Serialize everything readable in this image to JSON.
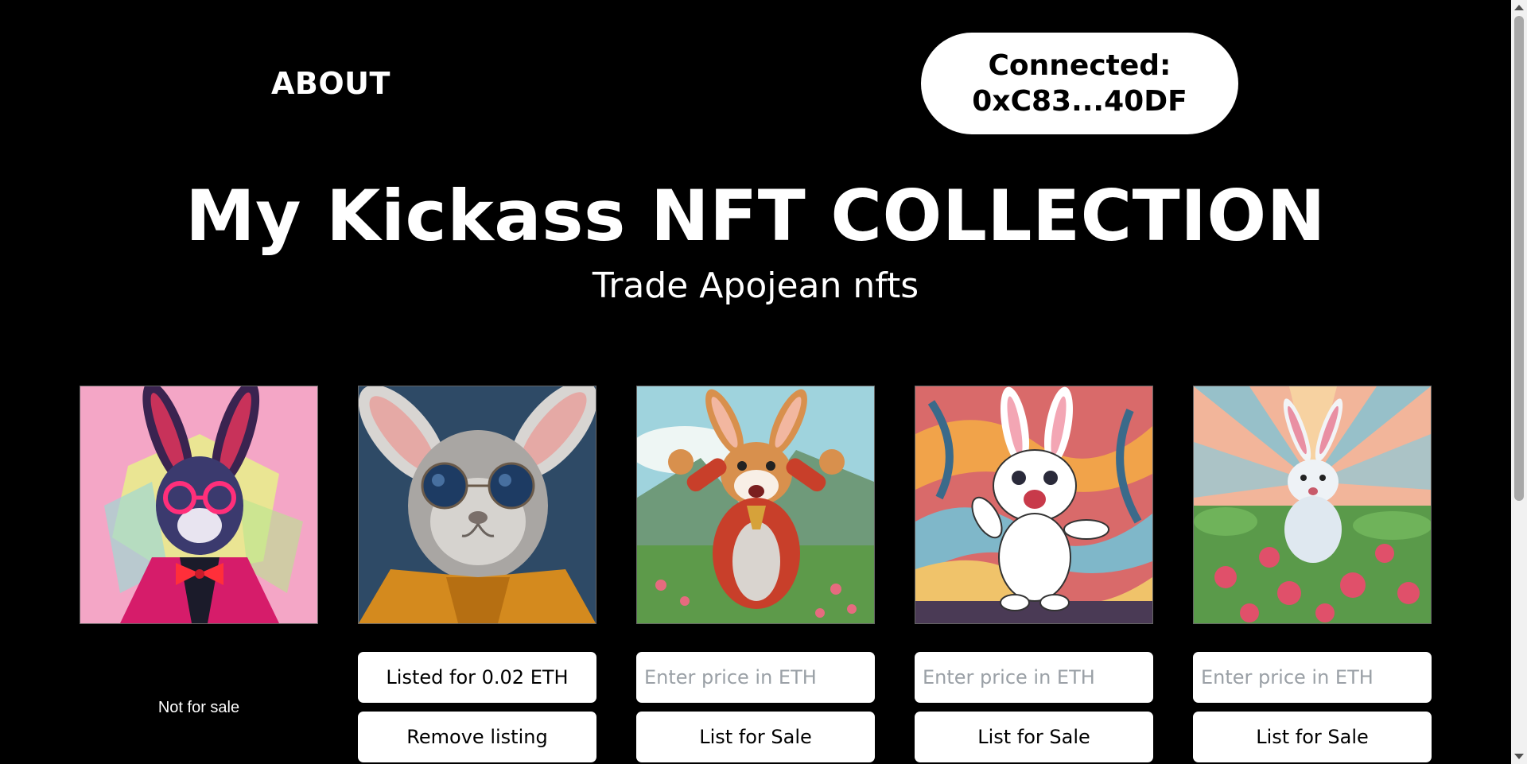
{
  "header": {
    "about_label": "ABOUT",
    "wallet_button_label": "Connected:\n0xC83...40DF"
  },
  "hero": {
    "title": "My Kickass NFT COLLECTION",
    "subtitle": "Trade Apojean nfts"
  },
  "nfts": [
    {
      "image_icon": "rabbit-pink-jacket-art",
      "status_text": "Not for sale"
    },
    {
      "image_icon": "rabbit-sunglasses-art",
      "listed_label": "Listed for 0.02 ETH",
      "remove_label": "Remove listing"
    },
    {
      "image_icon": "rabbit-cheering-art",
      "price_placeholder": "Enter price in ETH",
      "list_label": "List for Sale"
    },
    {
      "image_icon": "rabbit-dancing-art",
      "price_placeholder": "Enter price in ETH",
      "list_label": "List for Sale"
    },
    {
      "image_icon": "rabbit-flower-field-art",
      "price_placeholder": "Enter price in ETH",
      "list_label": "List for Sale"
    }
  ],
  "colors": {
    "background": "#000000",
    "text": "#ffffff",
    "button_bg": "#ffffff",
    "button_text": "#000000",
    "placeholder": "#9aa0a6"
  }
}
